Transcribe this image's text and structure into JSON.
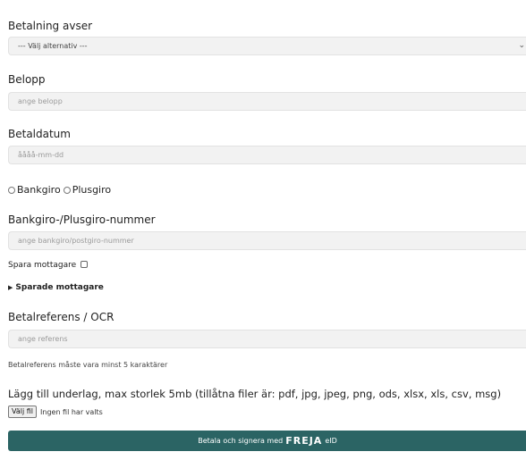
{
  "payment_for": {
    "label": "Betalning avser",
    "selected": "--- Välj alternativ ---"
  },
  "amount": {
    "label": "Belopp",
    "placeholder": "ange belopp"
  },
  "pay_date": {
    "label": "Betaldatum",
    "placeholder": "åååå-mm-dd"
  },
  "account_type": {
    "options": [
      "Bankgiro",
      "Plusgiro"
    ]
  },
  "account_number": {
    "label": "Bankgiro-/Plusgiro-nummer",
    "placeholder": "ange bankgiro/postgiro-nummer"
  },
  "save_recipient": {
    "label": "Spara mottagare",
    "checked": false
  },
  "saved_recipients": {
    "label": "Sparade mottagare"
  },
  "reference": {
    "label": "Betalreferens / OCR",
    "placeholder": "ange referens",
    "hint": "Betalreferens måste vara minst 5 karaktärer"
  },
  "upload": {
    "label": "Lägg till underlag, max storlek 5mb (tillåtna filer är: pdf, jpg, jpeg, png, ods, xlsx, xls, csv, msg)",
    "button": "Välj fil",
    "status": "Ingen fil har valts"
  },
  "submit": {
    "prefix": "Betala och signera med",
    "brand": "FREJA",
    "suffix": "eID",
    "color": "#2b6464"
  }
}
